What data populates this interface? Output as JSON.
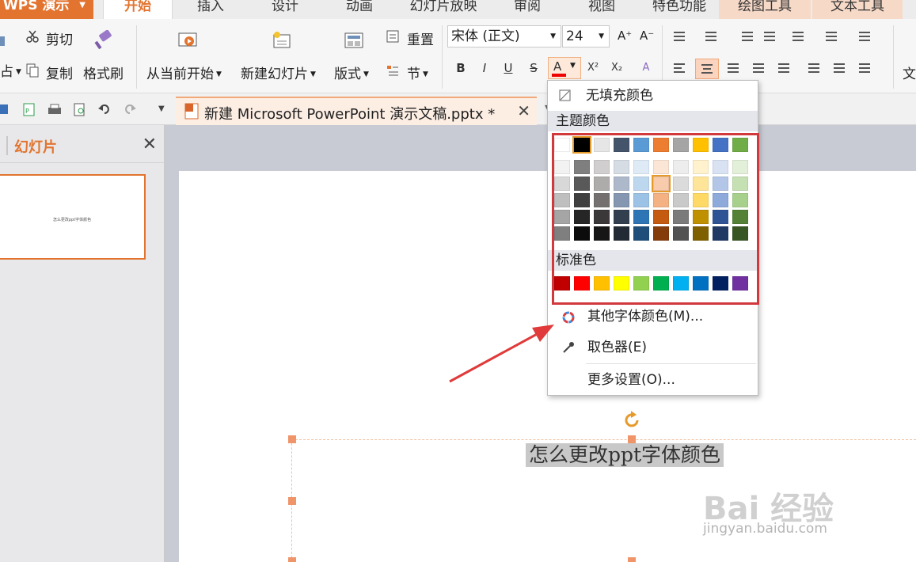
{
  "app": {
    "name": "WPS 演示"
  },
  "tabs": [
    {
      "label": "开始"
    },
    {
      "label": "插入"
    },
    {
      "label": "设计"
    },
    {
      "label": "动画"
    },
    {
      "label": "幻灯片放映"
    },
    {
      "label": "审阅"
    },
    {
      "label": "视图"
    },
    {
      "label": "特色功能"
    },
    {
      "label": "绘图工具"
    },
    {
      "label": "文本工具"
    }
  ],
  "ribbon": {
    "cut": "剪切",
    "copy": "复制",
    "format_painter": "格式刷",
    "paste_fragment": "占",
    "from_start": "从当前开始",
    "new_slide": "新建幻灯片",
    "layout": "版式",
    "reset": "重置",
    "section": "节",
    "font_name": "宋体 (正文)",
    "font_size": "24",
    "grow_font": "A⁺",
    "shrink_font": "A⁻",
    "bold": "B",
    "italic": "I",
    "underline": "U",
    "strikethrough": "S",
    "font_color": "A",
    "superscript": "X²",
    "subscript": "X₂",
    "clear_format": "A",
    "text_frag": "文"
  },
  "document": {
    "tab_title": "新建 Microsoft PowerPoint 演示文稿.pptx *"
  },
  "panel": {
    "title": "幻灯片",
    "thumb_text": "怎么更改ppt字体颜色"
  },
  "slide": {
    "text": "怎么更改ppt字体颜色"
  },
  "color_menu": {
    "no_fill": "无填充颜色",
    "theme_colors_header": "主题颜色",
    "standard_colors_header": "标准色",
    "more_colors": "其他字体颜色(M)...",
    "eyedropper": "取色器(E)",
    "more_settings": "更多设置(O)...",
    "theme_top": [
      "#ffffff",
      "#000000",
      "#e7e6e6",
      "#44546a",
      "#5b9bd5",
      "#ed7d31",
      "#a5a5a5",
      "#ffc000",
      "#4472c4",
      "#70ad47"
    ],
    "theme_shades": [
      [
        "#f2f2f2",
        "#7f7f7f",
        "#d0cece",
        "#d6dce4",
        "#deebf6",
        "#fbe5d5",
        "#ededed",
        "#fff2cc",
        "#d9e2f3",
        "#e2efd9"
      ],
      [
        "#d8d8d8",
        "#595959",
        "#aeabab",
        "#adb9ca",
        "#bdd7ee",
        "#f7cbac",
        "#dbdbdb",
        "#fee599",
        "#b4c6e7",
        "#c5e0b3"
      ],
      [
        "#bfbfbf",
        "#3f3f3f",
        "#757070",
        "#8496b0",
        "#9cc3e5",
        "#f4b183",
        "#c9c9c9",
        "#ffd965",
        "#8eaadb",
        "#a8d08d"
      ],
      [
        "#a5a5a5",
        "#262626",
        "#3a3838",
        "#323f4f",
        "#2e75b5",
        "#c55a11",
        "#7b7b7b",
        "#bf9000",
        "#2f5496",
        "#538135"
      ],
      [
        "#7f7f7f",
        "#0c0c0c",
        "#171616",
        "#222a35",
        "#1e4e79",
        "#843c0b",
        "#525252",
        "#7f6000",
        "#1f3864",
        "#375623"
      ]
    ],
    "standard": [
      "#c00000",
      "#ff0000",
      "#ffc000",
      "#ffff00",
      "#92d050",
      "#00b050",
      "#00b0f0",
      "#0070c0",
      "#002060",
      "#7030a0"
    ]
  },
  "watermark": {
    "brand": "Bai 经验",
    "url": "jingyan.baidu.com"
  }
}
